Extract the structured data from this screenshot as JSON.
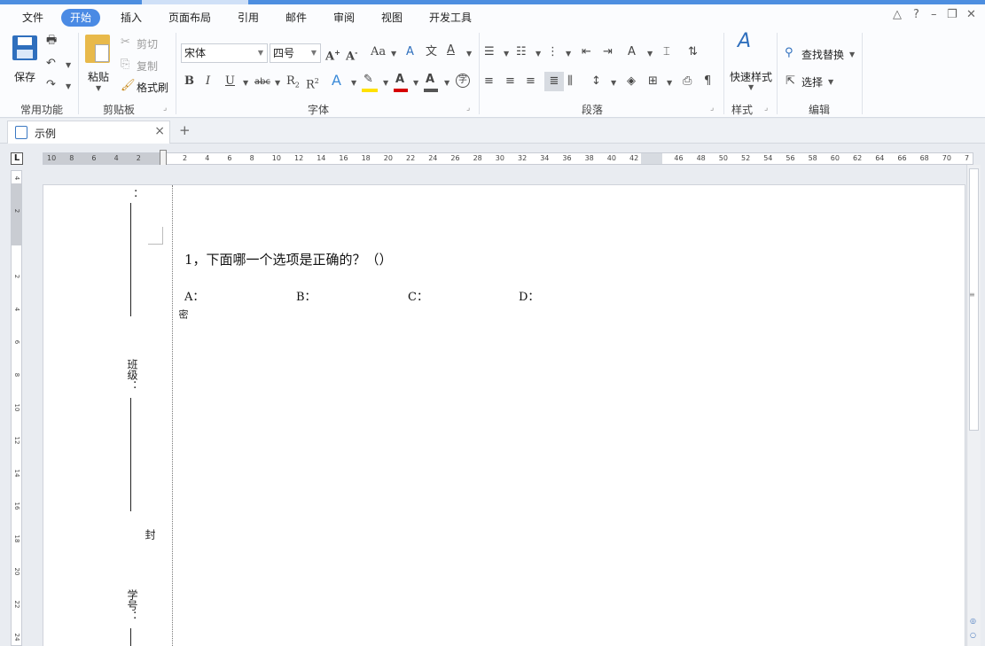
{
  "menu": {
    "items": [
      "文件",
      "开始",
      "插入",
      "页面布局",
      "引用",
      "邮件",
      "审阅",
      "视图",
      "开发工具"
    ],
    "active_index": 1
  },
  "ribbon": {
    "common": {
      "save": "保存",
      "group_label": "常用功能"
    },
    "clipboard": {
      "paste": "粘贴",
      "cut": "剪切",
      "copy": "复制",
      "format_painter": "格式刷",
      "group_label": "剪贴板"
    },
    "font": {
      "font_name": "宋体",
      "font_size": "四号",
      "group_label": "字体",
      "font_color": "#d60000",
      "highlight_color": "#ffe100"
    },
    "paragraph": {
      "group_label": "段落"
    },
    "style": {
      "quick_styles": "快速样式",
      "group_label": "样式"
    },
    "edit": {
      "find_replace": "查找替换",
      "select": "选择",
      "group_label": "编辑"
    }
  },
  "tabs": {
    "doc_name": "示例"
  },
  "ruler": {
    "h_left": [
      "10",
      "8",
      "6",
      "4",
      "2"
    ],
    "h_right": [
      "2",
      "4",
      "6",
      "8",
      "10",
      "12",
      "14",
      "16",
      "18",
      "20",
      "22",
      "24",
      "26",
      "28",
      "30",
      "32",
      "34",
      "36",
      "38",
      "40",
      "42",
      "",
      "46",
      "48",
      "50",
      "52",
      "54",
      "56",
      "58",
      "60",
      "62",
      "64",
      "66",
      "68",
      "70",
      "7"
    ],
    "v": [
      "4",
      "2",
      "",
      "2",
      "4",
      "6",
      "8",
      "10",
      "12",
      "14",
      "16",
      "18",
      "20",
      "22",
      "24"
    ]
  },
  "document": {
    "binding": {
      "top_colon": "：",
      "ban_ji": "班级：",
      "feng": "封",
      "xue_hao": "学号：",
      "mi": "密"
    },
    "question": "1，下面哪一个选项是正确的？（）",
    "options": [
      "A：",
      "B：",
      "C：",
      "D："
    ]
  },
  "colors": {
    "accent": "#4a8ae4"
  }
}
